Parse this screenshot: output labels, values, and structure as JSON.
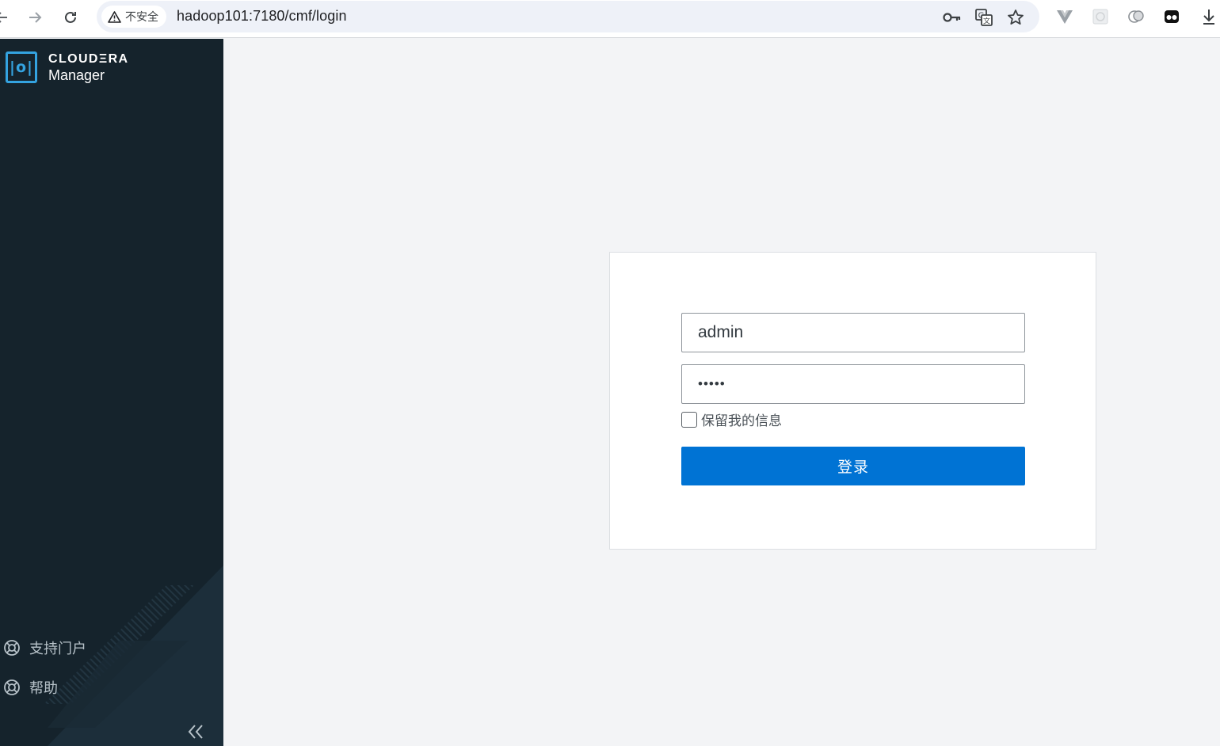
{
  "browser": {
    "security_label": "不安全",
    "url": "hadoop101:7180/cmf/login",
    "icons": [
      "back-arrow-icon",
      "forward-arrow-icon",
      "reload-icon",
      "warning-icon",
      "key-icon",
      "translate-icon",
      "star-icon",
      "vue-devtools-icon",
      "extension-icon",
      "extension-icon",
      "extension-icon",
      "download-icon"
    ]
  },
  "sidebar": {
    "logo_glyph": "|o|",
    "brand_name": "CLOUDΞRA",
    "product_name": "Manager",
    "links": [
      {
        "label": "支持门户",
        "icon": "lifebuoy-icon"
      },
      {
        "label": "帮助",
        "icon": "lifebuoy-icon"
      }
    ],
    "collapse_icon": "double-chevron-left-icon"
  },
  "login": {
    "username_value": "admin",
    "password_value": "•••••",
    "remember_label": "保留我的信息",
    "remember_checked": false,
    "submit_label": "登录"
  },
  "colors": {
    "sidebar_bg": "#15232c",
    "brand_accent": "#34a3e0",
    "page_bg": "#f3f4f6",
    "primary_button": "#0073d4"
  }
}
